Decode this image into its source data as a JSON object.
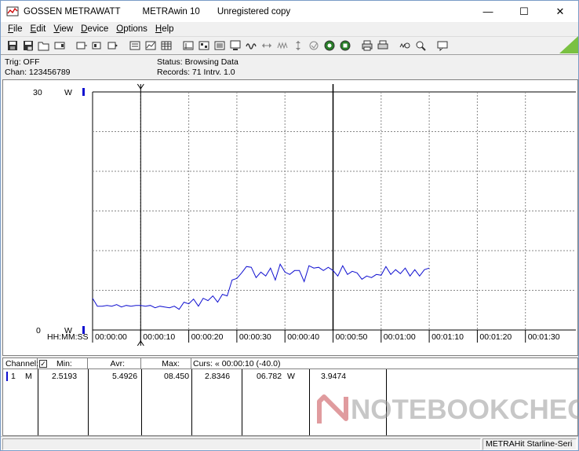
{
  "window": {
    "title_parts": [
      "GOSSEN METRAWATT",
      "METRAwin 10",
      "Unregistered copy"
    ],
    "controls": {
      "minimize": "—",
      "maximize": "☐",
      "close": "✕"
    }
  },
  "menu": [
    {
      "u": "F",
      "rest": "ile"
    },
    {
      "u": "E",
      "rest": "dit"
    },
    {
      "u": "V",
      "rest": "iew"
    },
    {
      "u": "D",
      "rest": "evice"
    },
    {
      "u": "O",
      "rest": "ptions"
    },
    {
      "u": "H",
      "rest": "elp"
    }
  ],
  "status": {
    "trig": "Trig: OFF",
    "chan": "Chan:  123456789",
    "status": "Status:   Browsing Data",
    "records": "Records: 71   Intrv. 1.0"
  },
  "chart_data": {
    "type": "line",
    "y_top_label": "30",
    "y_bottom_label": "0",
    "y_unit_top": "W",
    "y_unit_bottom": "W",
    "ylim": [
      0,
      30
    ],
    "xlim": [
      0,
      80
    ],
    "time_axis_label": "HH:MM:SS",
    "x_ticks": [
      "00:00:00",
      "00:00:10",
      "00:00:20",
      "00:00:30",
      "00:00:40",
      "00:00:50",
      "00:01:00",
      "00:01:10",
      "00:01:20",
      "00:01:30"
    ],
    "cursor_1_s": 10,
    "cursor_2_s": 50,
    "grid": true,
    "series_color": "#1010d0",
    "x": [
      0,
      1,
      2,
      3,
      4,
      5,
      6,
      7,
      8,
      9,
      10,
      11,
      12,
      13,
      14,
      15,
      16,
      17,
      18,
      19,
      20,
      21,
      22,
      23,
      24,
      25,
      26,
      27,
      28,
      29,
      30,
      31,
      32,
      33,
      34,
      35,
      36,
      37,
      38,
      39,
      40,
      41,
      42,
      43,
      44,
      45,
      46,
      47,
      48,
      49,
      50,
      51,
      52,
      53,
      54,
      55,
      56,
      57,
      58,
      59,
      60,
      61,
      62,
      63,
      64,
      65,
      66,
      67,
      68,
      69,
      70
    ],
    "values": [
      4.0,
      3.0,
      3.0,
      3.1,
      3.0,
      3.2,
      2.9,
      3.1,
      3.0,
      3.1,
      3.1,
      3.0,
      3.1,
      2.8,
      3.0,
      2.9,
      2.8,
      3.0,
      2.6,
      3.5,
      3.3,
      3.9,
      3.0,
      4.0,
      3.7,
      4.3,
      3.5,
      4.5,
      4.3,
      6.3,
      6.5,
      7.2,
      8.0,
      7.9,
      6.6,
      7.3,
      6.8,
      7.8,
      6.3,
      8.3,
      7.3,
      7.0,
      7.5,
      7.5,
      6.1,
      8.1,
      7.8,
      7.9,
      7.5,
      7.9,
      7.5,
      6.8,
      8.1,
      7.0,
      7.4,
      7.2,
      6.4,
      6.8,
      6.6,
      7.0,
      6.9,
      8.0,
      7.0,
      7.6,
      7.1,
      7.8,
      6.8,
      7.6,
      6.8,
      7.6,
      7.8
    ]
  },
  "table": {
    "headers": {
      "channel": "Channel:",
      "min": "Min:",
      "avr": "Avr:",
      "max": "Max:",
      "curs": "Curs: « 00:00:10 (-40.0)"
    },
    "row": {
      "chan_num": "1",
      "chan_mode": "M",
      "min": "2.5193",
      "avr": "5.4926",
      "max": "08.450",
      "curs1": "2.8346",
      "curs2": "06.782",
      "unit": "W",
      "diff": "3.9474"
    }
  },
  "watermark": {
    "text": "NOTEBOOKCHECK",
    "color": "#b81c22"
  },
  "statusbar": {
    "device": "METRAHit Starline-Seri"
  }
}
